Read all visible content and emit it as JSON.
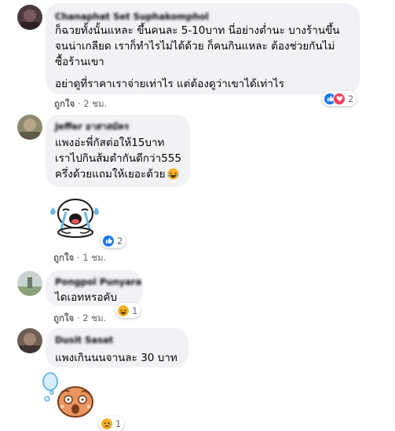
{
  "comments": [
    {
      "author": "Chanaphat Set Suphakomphol",
      "lines": [
        "ก็ฉวยทั้งนั้นแหละ ขึ้นคนละ 5-10บาท นี่อย่างต่ำนะ บางร้านขึ้น",
        "จนน่าเกลียด เราก็ทำไรไม่ได้ด้วย ก็คนกินแหละ ต้องช่วยกันไม่",
        "ซื้อร้านเขา",
        "อย่าดูที่ราคาเราจ่ายเท่าไร แต่ต้องดูว่าเขาได้เท่าไร"
      ],
      "like_label": "ถูกใจ",
      "sep": "·",
      "time": "2 ชม.",
      "reaction_count": "2",
      "reaction_icons": [
        "like-icon",
        "love-icon"
      ]
    },
    {
      "author": "Jeffer อาสาสมัคร",
      "lines": [
        "แพงอ่ะพี่กัสต่อให้15บาท",
        "เราไปกินส้มตำกันดีกว่า555",
        "ครึ่งด้วยแถมให้เยอะด้วย"
      ],
      "emoji_icon": "laughing-emoji-icon",
      "sticker": "crying-sticker-icon",
      "like_label": "ถูกใจ",
      "sep": "·",
      "time": "1 ชม.",
      "reaction_count": "2",
      "reaction_icons": [
        "like-icon"
      ]
    },
    {
      "author": "Pongpol Punyara",
      "lines": [
        "ไดเอทหรอคับ"
      ],
      "like_label": "ถูกใจ",
      "sep": "·",
      "time": "2 ชม.",
      "reaction_count": "1",
      "reaction_icons": [
        "haha-icon"
      ]
    },
    {
      "author": "Dusit Sasat",
      "lines": [
        "แพงเกินนนจานละ 30 บาท"
      ],
      "sticker": "shocked-sticker-icon",
      "reaction_count": "1",
      "reaction_icons": [
        "sad-icon"
      ]
    }
  ],
  "colors": {
    "bubble": "#f0f2f5",
    "meta_text": "#65676b",
    "like_blue": "#1877f2",
    "love_red": "#f33e58",
    "emoji_yellow": "#f7b125"
  }
}
